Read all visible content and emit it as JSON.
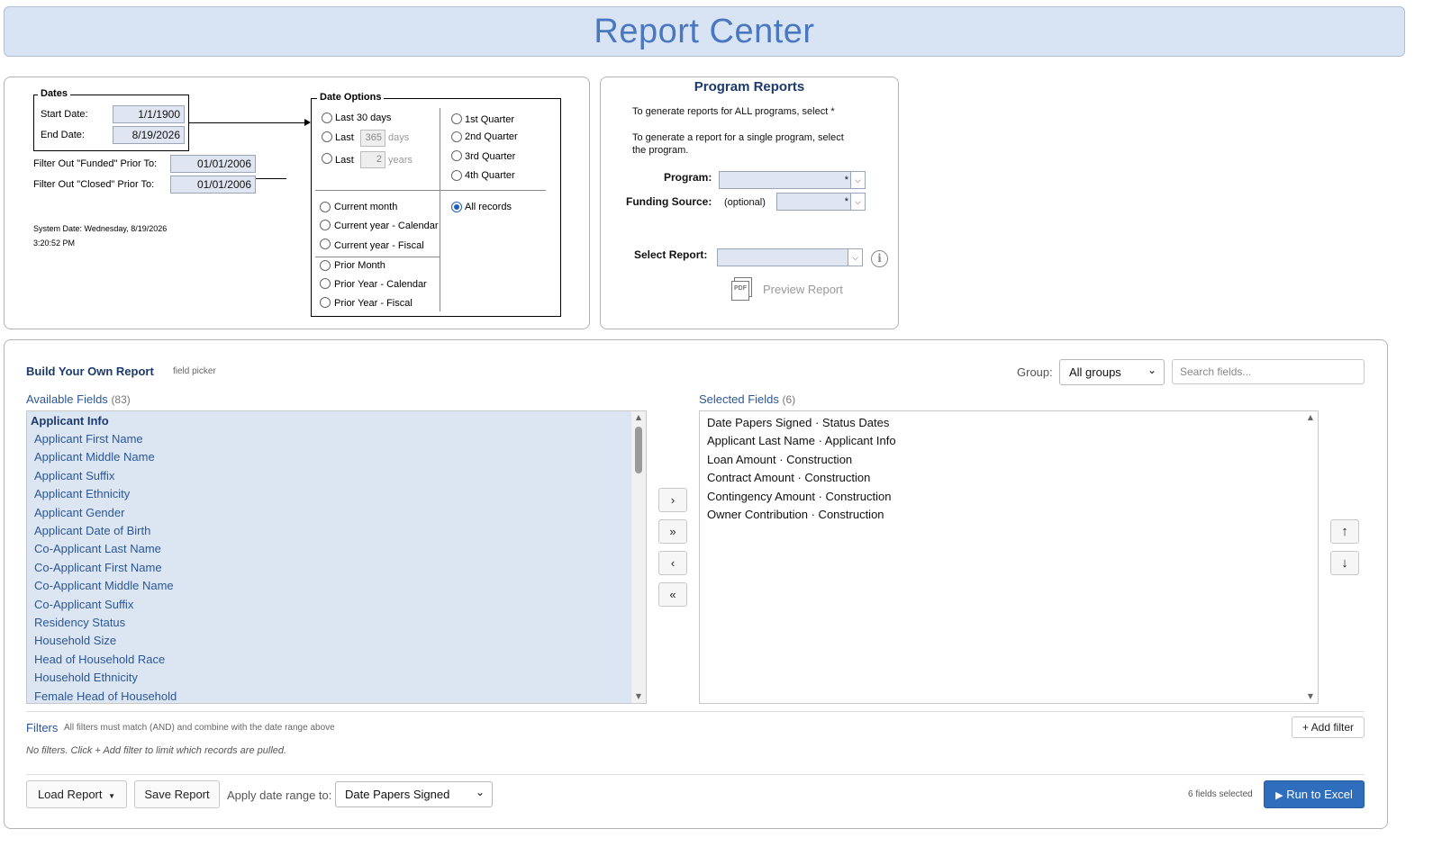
{
  "header": {
    "title": "Report Center"
  },
  "dates": {
    "legend": "Dates",
    "start_label": "Start Date:",
    "start_value": "1/1/1900",
    "end_label": "End Date:",
    "end_value": "8/19/2026",
    "funded_label": "Filter Out \"Funded\" Prior To:",
    "funded_value": "01/01/2006",
    "closed_label": "Filter Out \"Closed\" Prior To:",
    "closed_value": "01/01/2006",
    "system_date_line1": "System Date: Wednesday, 8/19/2026",
    "system_date_line2": "3:20:52 PM"
  },
  "date_options": {
    "legend": "Date Options",
    "last30": "Last 30 days",
    "last_label": "Last",
    "last_days_value": "365",
    "days_unit": "days",
    "last_years_value": "2",
    "years_unit": "years",
    "q1": "1st Quarter",
    "q2": "2nd Quarter",
    "q3": "3rd Quarter",
    "q4": "4th Quarter",
    "current_month": "Current month",
    "current_year_cal": "Current year - Calendar",
    "current_year_fiscal": "Current year - Fiscal",
    "prior_month": "Prior Month",
    "prior_year_cal": "Prior Year - Calendar",
    "prior_year_fiscal": "Prior Year - Fiscal",
    "all_records": "All records",
    "selected": "All records"
  },
  "program_reports": {
    "title": "Program Reports",
    "text_all": "To generate reports for ALL programs, select *",
    "text_single_1": "To generate a report for a single program, select",
    "text_single_2": "the program.",
    "program_label": "Program:",
    "program_value": "*",
    "funding_label": "Funding Source:",
    "funding_optional": "(optional)",
    "funding_value": "*",
    "select_report_label": "Select Report:",
    "select_report_value": "",
    "preview_label": "Preview Report",
    "pdf_text": "PDF"
  },
  "builder": {
    "title": "Build Your Own Report",
    "subtitle": "field picker",
    "group_label": "Group:",
    "group_value": "All groups",
    "search_placeholder": "Search fields...",
    "available_label": "Available Fields",
    "available_count": "(83)",
    "selected_label": "Selected Fields",
    "selected_count": "(6)",
    "available_group": "Applicant Info",
    "available_fields": [
      "Applicant First Name",
      "Applicant Middle Name",
      "Applicant Suffix",
      "Applicant Ethnicity",
      "Applicant Gender",
      "Applicant Date of Birth",
      "Co-Applicant Last Name",
      "Co-Applicant First Name",
      "Co-Applicant Middle Name",
      "Co-Applicant Suffix",
      "Residency Status",
      "Household Size",
      "Head of Household Race",
      "Household Ethnicity",
      "Female Head of Household"
    ],
    "selected_fields": [
      "Date Papers Signed · Status Dates",
      "Applicant Last Name · Applicant Info",
      "Loan Amount · Construction",
      "Contract Amount · Construction",
      "Contingency Amount · Construction",
      "Owner Contribution · Construction"
    ],
    "move_buttons": [
      "›",
      "»",
      "‹",
      "«"
    ],
    "order_buttons": [
      "↑",
      "↓"
    ],
    "filters_label": "Filters",
    "filters_desc": "All filters must match (AND) and combine with the date range above",
    "add_filter": "+ Add filter",
    "no_filters": "No filters. Click + Add filter to limit which records are pulled.",
    "load_report": "Load Report",
    "save_report": "Save Report",
    "apply_label": "Apply date range to:",
    "apply_value": "Date Papers Signed",
    "fields_selected": "6 fields selected",
    "run_excel": "Run to Excel"
  }
}
